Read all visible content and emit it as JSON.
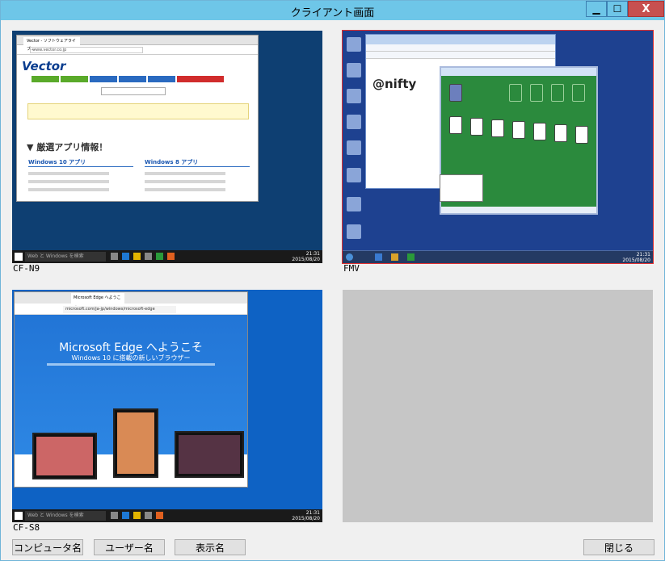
{
  "window": {
    "title": "クライアント画面",
    "min_label": "▁",
    "max_label": "☐",
    "close_label": "X"
  },
  "clients": [
    {
      "label": "CF-N9",
      "browser_tab": "Vector - ソフトウェアライブ…",
      "address": "www.vector.co.jp",
      "logo": "Vector",
      "heading": "▼ 厳選アプリ情報！",
      "col1": "Windows 10 アプリ",
      "col2": "Windows 8 アプリ",
      "search_box": "Web と Windows を検索",
      "clock_time": "21:31",
      "clock_date": "2015/08/20"
    },
    {
      "label": "FMV",
      "logo": "@nifty",
      "clock_time": "21:31",
      "clock_date": "2015/08/20"
    },
    {
      "label": "CF-S8",
      "browser_tab": "Microsoft Edge へようこそ",
      "address": "microsoft.com/ja-jp/windows/microsoft-edge",
      "hero_title": "Microsoft Edge へようこそ",
      "hero_sub": "Windows 10 に搭載の新しいブラウザー",
      "search_box": "Web と Windows を検索",
      "clock_time": "21:31",
      "clock_date": "2015/08/20"
    }
  ],
  "buttons": {
    "computer_name": "コンピュータ名",
    "user_name": "ユーザー名",
    "display_name": "表示名",
    "close": "閉じる"
  }
}
